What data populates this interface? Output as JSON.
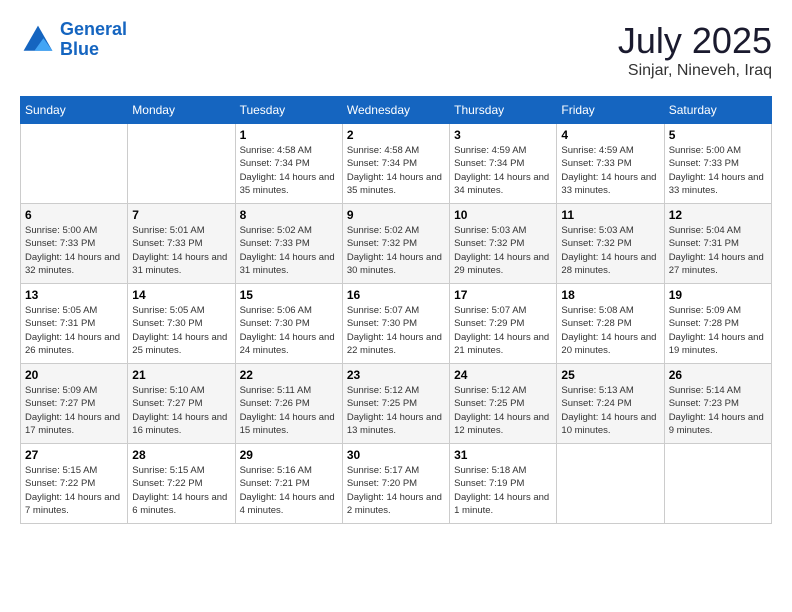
{
  "logo": {
    "line1": "General",
    "line2": "Blue"
  },
  "title": "July 2025",
  "location": "Sinjar, Nineveh, Iraq",
  "weekdays": [
    "Sunday",
    "Monday",
    "Tuesday",
    "Wednesday",
    "Thursday",
    "Friday",
    "Saturday"
  ],
  "weeks": [
    [
      {
        "day": "",
        "info": ""
      },
      {
        "day": "",
        "info": ""
      },
      {
        "day": "1",
        "info": "Sunrise: 4:58 AM\nSunset: 7:34 PM\nDaylight: 14 hours and 35 minutes."
      },
      {
        "day": "2",
        "info": "Sunrise: 4:58 AM\nSunset: 7:34 PM\nDaylight: 14 hours and 35 minutes."
      },
      {
        "day": "3",
        "info": "Sunrise: 4:59 AM\nSunset: 7:34 PM\nDaylight: 14 hours and 34 minutes."
      },
      {
        "day": "4",
        "info": "Sunrise: 4:59 AM\nSunset: 7:33 PM\nDaylight: 14 hours and 33 minutes."
      },
      {
        "day": "5",
        "info": "Sunrise: 5:00 AM\nSunset: 7:33 PM\nDaylight: 14 hours and 33 minutes."
      }
    ],
    [
      {
        "day": "6",
        "info": "Sunrise: 5:00 AM\nSunset: 7:33 PM\nDaylight: 14 hours and 32 minutes."
      },
      {
        "day": "7",
        "info": "Sunrise: 5:01 AM\nSunset: 7:33 PM\nDaylight: 14 hours and 31 minutes."
      },
      {
        "day": "8",
        "info": "Sunrise: 5:02 AM\nSunset: 7:33 PM\nDaylight: 14 hours and 31 minutes."
      },
      {
        "day": "9",
        "info": "Sunrise: 5:02 AM\nSunset: 7:32 PM\nDaylight: 14 hours and 30 minutes."
      },
      {
        "day": "10",
        "info": "Sunrise: 5:03 AM\nSunset: 7:32 PM\nDaylight: 14 hours and 29 minutes."
      },
      {
        "day": "11",
        "info": "Sunrise: 5:03 AM\nSunset: 7:32 PM\nDaylight: 14 hours and 28 minutes."
      },
      {
        "day": "12",
        "info": "Sunrise: 5:04 AM\nSunset: 7:31 PM\nDaylight: 14 hours and 27 minutes."
      }
    ],
    [
      {
        "day": "13",
        "info": "Sunrise: 5:05 AM\nSunset: 7:31 PM\nDaylight: 14 hours and 26 minutes."
      },
      {
        "day": "14",
        "info": "Sunrise: 5:05 AM\nSunset: 7:30 PM\nDaylight: 14 hours and 25 minutes."
      },
      {
        "day": "15",
        "info": "Sunrise: 5:06 AM\nSunset: 7:30 PM\nDaylight: 14 hours and 24 minutes."
      },
      {
        "day": "16",
        "info": "Sunrise: 5:07 AM\nSunset: 7:30 PM\nDaylight: 14 hours and 22 minutes."
      },
      {
        "day": "17",
        "info": "Sunrise: 5:07 AM\nSunset: 7:29 PM\nDaylight: 14 hours and 21 minutes."
      },
      {
        "day": "18",
        "info": "Sunrise: 5:08 AM\nSunset: 7:28 PM\nDaylight: 14 hours and 20 minutes."
      },
      {
        "day": "19",
        "info": "Sunrise: 5:09 AM\nSunset: 7:28 PM\nDaylight: 14 hours and 19 minutes."
      }
    ],
    [
      {
        "day": "20",
        "info": "Sunrise: 5:09 AM\nSunset: 7:27 PM\nDaylight: 14 hours and 17 minutes."
      },
      {
        "day": "21",
        "info": "Sunrise: 5:10 AM\nSunset: 7:27 PM\nDaylight: 14 hours and 16 minutes."
      },
      {
        "day": "22",
        "info": "Sunrise: 5:11 AM\nSunset: 7:26 PM\nDaylight: 14 hours and 15 minutes."
      },
      {
        "day": "23",
        "info": "Sunrise: 5:12 AM\nSunset: 7:25 PM\nDaylight: 14 hours and 13 minutes."
      },
      {
        "day": "24",
        "info": "Sunrise: 5:12 AM\nSunset: 7:25 PM\nDaylight: 14 hours and 12 minutes."
      },
      {
        "day": "25",
        "info": "Sunrise: 5:13 AM\nSunset: 7:24 PM\nDaylight: 14 hours and 10 minutes."
      },
      {
        "day": "26",
        "info": "Sunrise: 5:14 AM\nSunset: 7:23 PM\nDaylight: 14 hours and 9 minutes."
      }
    ],
    [
      {
        "day": "27",
        "info": "Sunrise: 5:15 AM\nSunset: 7:22 PM\nDaylight: 14 hours and 7 minutes."
      },
      {
        "day": "28",
        "info": "Sunrise: 5:15 AM\nSunset: 7:22 PM\nDaylight: 14 hours and 6 minutes."
      },
      {
        "day": "29",
        "info": "Sunrise: 5:16 AM\nSunset: 7:21 PM\nDaylight: 14 hours and 4 minutes."
      },
      {
        "day": "30",
        "info": "Sunrise: 5:17 AM\nSunset: 7:20 PM\nDaylight: 14 hours and 2 minutes."
      },
      {
        "day": "31",
        "info": "Sunrise: 5:18 AM\nSunset: 7:19 PM\nDaylight: 14 hours and 1 minute."
      },
      {
        "day": "",
        "info": ""
      },
      {
        "day": "",
        "info": ""
      }
    ]
  ]
}
